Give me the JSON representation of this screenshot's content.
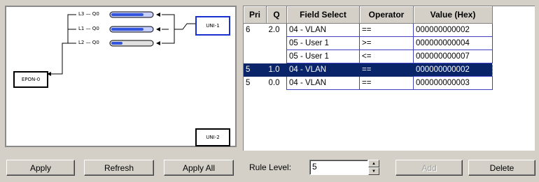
{
  "diagram": {
    "uni1_label": "UNI-1",
    "uni2_label": "UNI-2",
    "epon_label": "EPON-0",
    "queue_labels": [
      "L3 — Q0",
      "L1 — Q0",
      "L2 — Q0"
    ],
    "pipe_color": "#3355dd"
  },
  "table": {
    "headers": [
      "Pri",
      "Q",
      "Field Select",
      "Operator",
      "Value (Hex)"
    ],
    "rows": [
      {
        "pri": "6",
        "q": "2.0",
        "field": "04 - VLAN",
        "op": "==",
        "value": "000000000002"
      },
      {
        "pri": "",
        "q": "",
        "field": "05 - User 1",
        "op": ">=",
        "value": "000000000004"
      },
      {
        "pri": "",
        "q": "",
        "field": "05 - User 1",
        "op": "<=",
        "value": "000000000007"
      },
      {
        "pri": "5",
        "q": "1.0",
        "field": "04 - VLAN",
        "op": "==",
        "value": "000000000002"
      },
      {
        "pri": "5",
        "q": "0.0",
        "field": "04 - VLAN",
        "op": "==",
        "value": "000000000003"
      }
    ],
    "selected_row": 3
  },
  "toolbar": {
    "apply": "Apply",
    "refresh": "Refresh",
    "apply_all": "Apply All",
    "rule_level_label": "Rule Level:",
    "rule_level_value": "5",
    "add": "Add",
    "delete": "Delete"
  },
  "colors": {
    "selection": "#0a246a",
    "grid_line": "#4040c0",
    "face": "#d4d0c8"
  }
}
